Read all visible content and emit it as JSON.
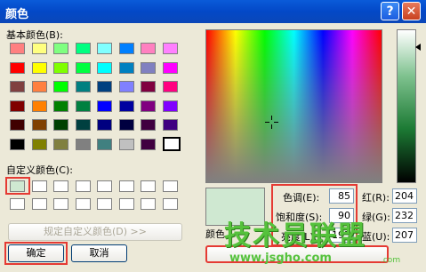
{
  "window": {
    "title": "颜色",
    "help": "?",
    "close": "✕"
  },
  "basic": {
    "label": "基本颜色(B):",
    "colors": [
      [
        "#ff8080",
        "#ffff80",
        "#80ff80",
        "#00ff80",
        "#80ffff",
        "#0080ff",
        "#ff80c0",
        "#ff80ff"
      ],
      [
        "#ff0000",
        "#ffff00",
        "#80ff00",
        "#00ff40",
        "#00ffff",
        "#0080c0",
        "#8080c0",
        "#ff00ff"
      ],
      [
        "#804040",
        "#ff8040",
        "#00ff00",
        "#008080",
        "#004080",
        "#8080ff",
        "#800040",
        "#ff0080"
      ],
      [
        "#800000",
        "#ff8000",
        "#008000",
        "#008040",
        "#0000ff",
        "#0000a0",
        "#800080",
        "#8000ff"
      ],
      [
        "#400000",
        "#804000",
        "#004000",
        "#004040",
        "#000080",
        "#000040",
        "#400040",
        "#400080"
      ],
      [
        "#000000",
        "#808000",
        "#808040",
        "#808080",
        "#408080",
        "#c0c0c0",
        "#400040",
        "#ffffff"
      ]
    ]
  },
  "custom": {
    "label": "自定义颜色(C):",
    "first_color": "#cfe8d1"
  },
  "define_button": "规定自定义颜色(D) >>",
  "ok_button": "确定",
  "cancel_button": "取消",
  "preview": {
    "label": "颜色",
    "color": "#cfe8d1"
  },
  "hsl": {
    "hue_label": "色调(E):",
    "hue": "85",
    "sat_label": "饱和度(S):",
    "sat": "90",
    "lum_label": "亮度(L):",
    "lum": "195"
  },
  "rgb": {
    "red_label": "红(R):",
    "red": "204",
    "green_label": "绿(G):",
    "green": "232",
    "blue_label": "蓝(U):",
    "blue": "207"
  },
  "watermark": {
    "text": "技术员联盟",
    "url": "www.jsgho.com",
    "com": ".com"
  }
}
